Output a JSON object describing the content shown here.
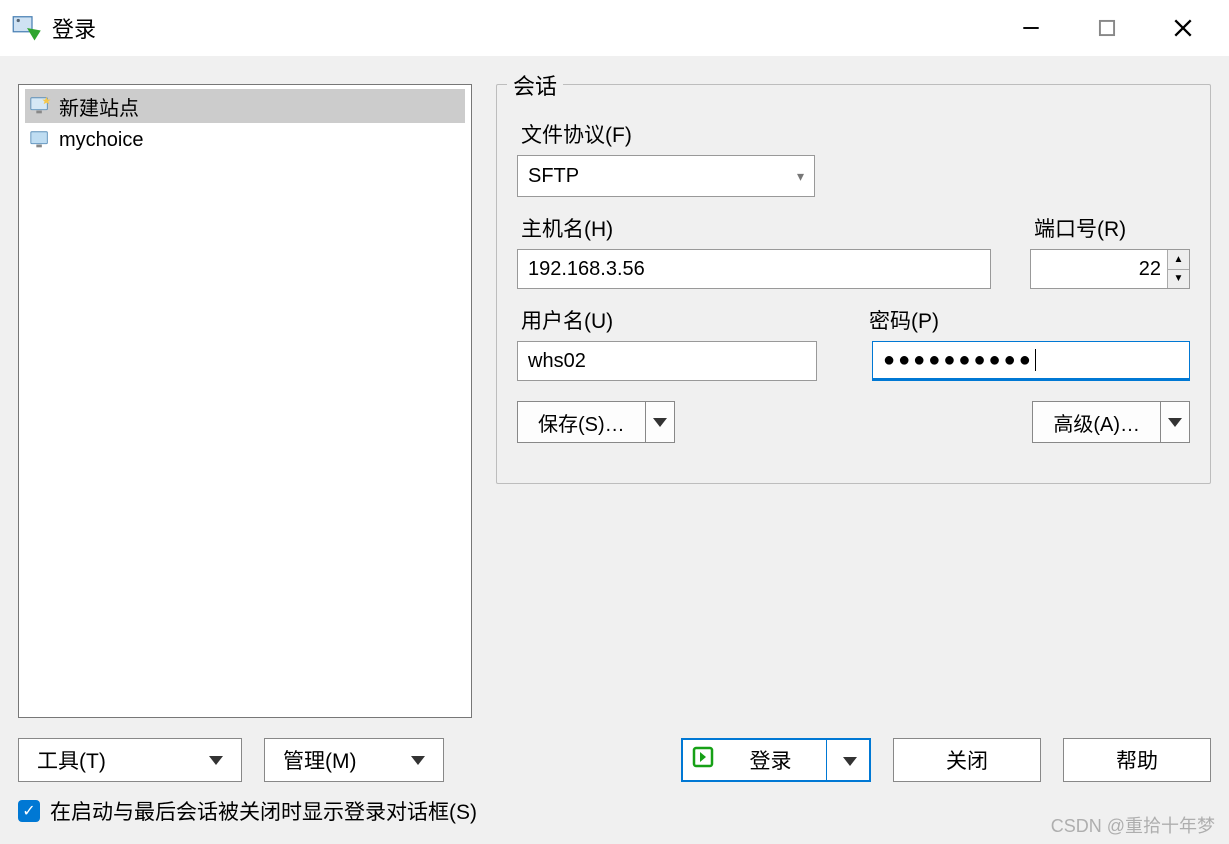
{
  "window": {
    "title": "登录"
  },
  "sites": [
    {
      "label": "新建站点",
      "selected": true,
      "icon": "monitor-star-icon"
    },
    {
      "label": "mychoice",
      "selected": false,
      "icon": "monitor-icon"
    }
  ],
  "session": {
    "panel_title": "会话",
    "protocol_label": "文件协议(F)",
    "protocol_value": "SFTP",
    "host_label": "主机名(H)",
    "host_value": "192.168.3.56",
    "port_label": "端口号(R)",
    "port_value": "22",
    "user_label": "用户名(U)",
    "user_value": "whs02",
    "pass_label": "密码(P)",
    "pass_mask": "●●●●●●●●●●",
    "save_label": "保存(S)…",
    "advanced_label": "高级(A)…"
  },
  "footer": {
    "tools_label": "工具(T)",
    "manage_label": "管理(M)",
    "login_label": "登录",
    "close_label": "关闭",
    "help_label": "帮助",
    "show_on_start_label": "在启动与最后会话被关闭时显示登录对话框(S)"
  },
  "watermark": "CSDN @重拾十年梦"
}
